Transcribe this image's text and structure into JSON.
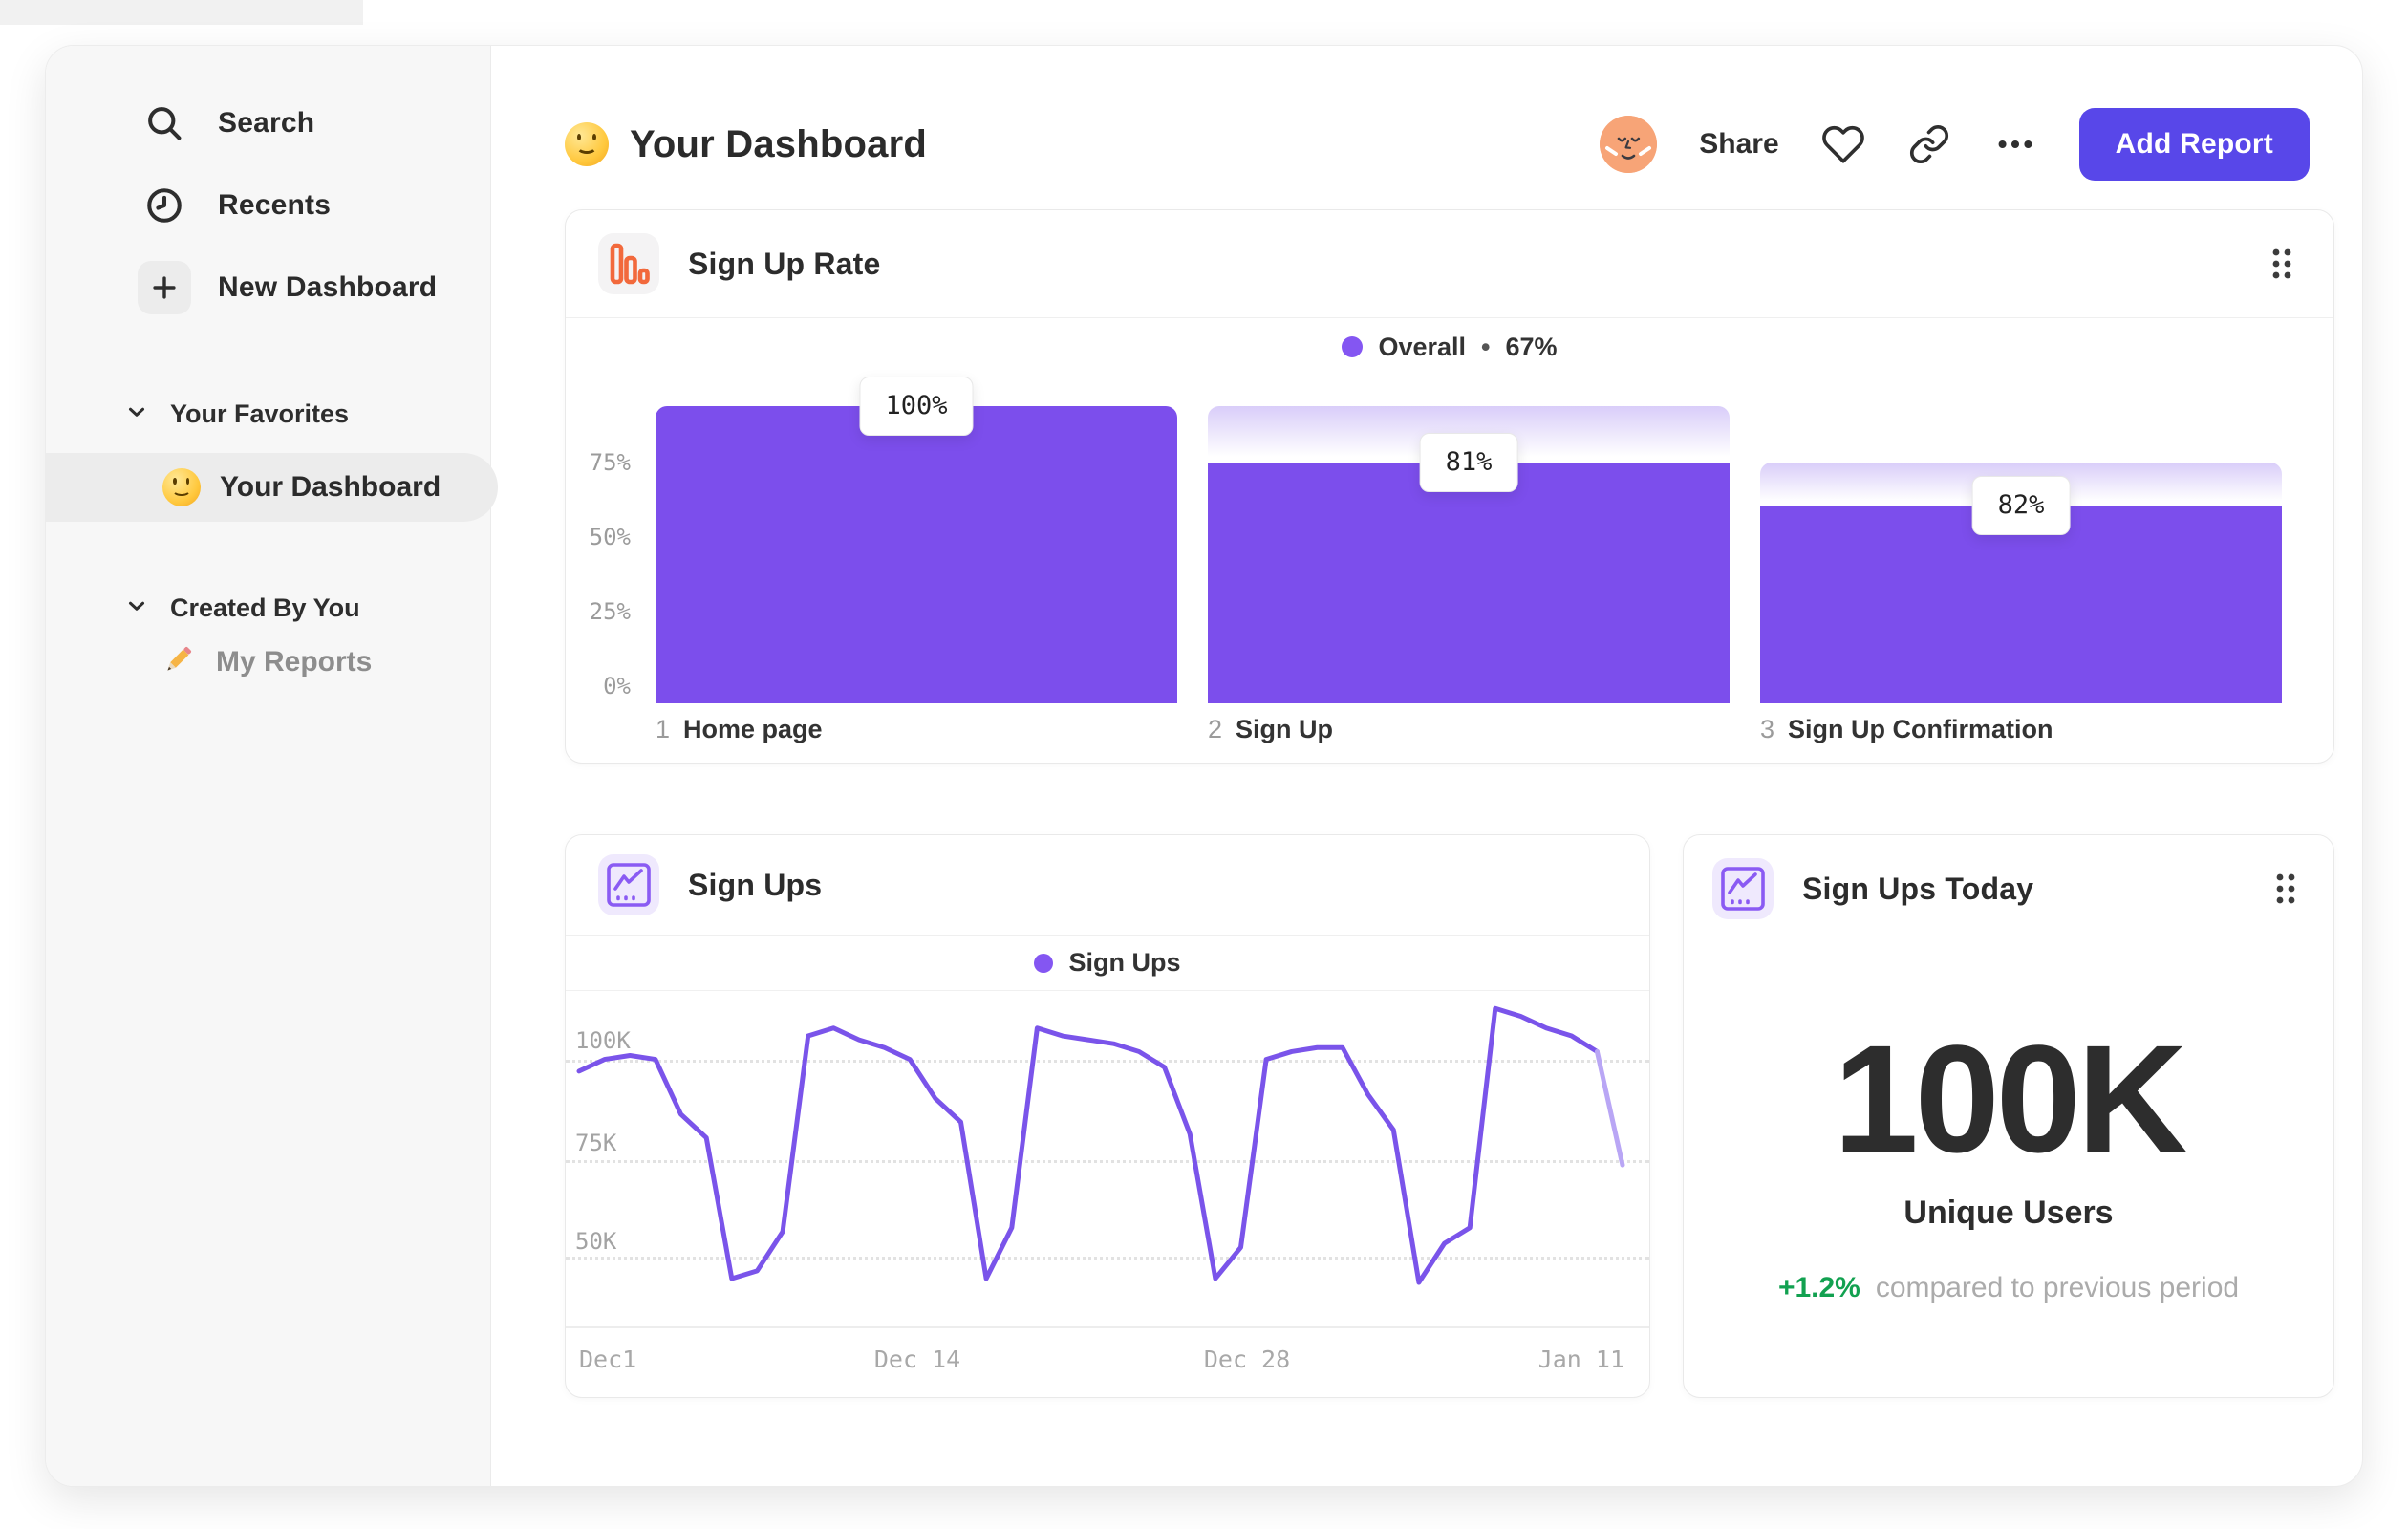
{
  "colors": {
    "bar_purple": "#7c4eec",
    "bar_ghost_top": "#d9cdf9",
    "line_purple": "#7a54ea",
    "line_fade": "#b9a6f5",
    "legend_dot": "#8456f2",
    "button_indigo": "#5847e9",
    "delta_green": "#12a150",
    "funnel_icon_orange": "#f2693c",
    "chart_icon_purple": "#8a5bf3",
    "avatar_peach": "#f7a477",
    "sidebar_bg": "#f7f7f7"
  },
  "sidebar": {
    "nav": [
      {
        "label": "Search",
        "icon": "search-icon"
      },
      {
        "label": "Recents",
        "icon": "clock-icon"
      },
      {
        "label": "New Dashboard",
        "icon": "plus-icon"
      }
    ],
    "sections": [
      {
        "title": "Your Favorites"
      },
      {
        "title": "Created By You"
      }
    ],
    "favorites_item": {
      "label": "Your Dashboard",
      "icon": "smiley-emoji",
      "active": true
    },
    "created_item": {
      "label": "My Reports",
      "icon": "pencil-emoji",
      "active": false
    }
  },
  "header": {
    "title": "Your Dashboard",
    "share_label": "Share",
    "add_report_label": "Add Report"
  },
  "chart_data": [
    {
      "type": "bar",
      "title": "Sign Up Rate",
      "legend_series": "Overall",
      "legend_sep": "•",
      "legend_value": "67%",
      "legend_position": "top-center",
      "categories": [
        "Home page",
        "Sign Up",
        "Sign Up Confirmation"
      ],
      "step_numbers": [
        "1",
        "2",
        "3"
      ],
      "values_pct_of_previous": [
        100,
        81,
        82
      ],
      "values_overall_pct": [
        100,
        81,
        66.4
      ],
      "bar_labels": [
        "100%",
        "81%",
        "82%"
      ],
      "yticks": [
        "75%",
        "50%",
        "25%",
        "0%"
      ],
      "ylim": [
        0,
        100
      ],
      "grid": false
    },
    {
      "type": "line",
      "title": "Sign Ups",
      "legend": "Sign Ups",
      "xticks": [
        "Dec1",
        "Dec 14",
        "Dec 28",
        "Jan 11"
      ],
      "yticks": [
        "100K",
        "75K",
        "50K"
      ],
      "unit": "thousands",
      "values": [
        97,
        100,
        101,
        100,
        86,
        80,
        44,
        46,
        56,
        106,
        108,
        105,
        103,
        100,
        90,
        84,
        44,
        57,
        108,
        106,
        105,
        104,
        102,
        98,
        81,
        44,
        52,
        100,
        102,
        103,
        103,
        91,
        82,
        43,
        53,
        57,
        113,
        111,
        108,
        106,
        102,
        73
      ],
      "ylim_kilo": [
        32,
        117
      ],
      "grid": "dotted-horizontal",
      "last_segment_faded": true
    },
    {
      "type": "number",
      "title": "Sign Ups Today",
      "value": "100K",
      "label": "Unique Users",
      "delta": "+1.2%",
      "delta_note": "compared to previous period"
    }
  ]
}
